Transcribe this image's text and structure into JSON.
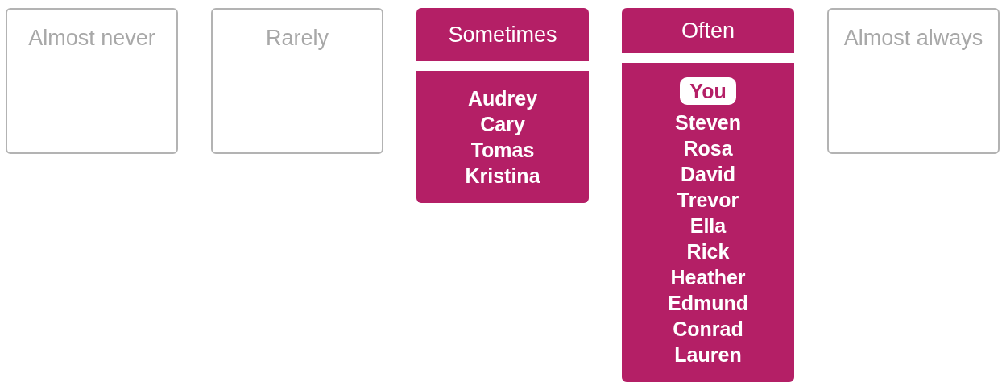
{
  "columns": [
    {
      "label": "Almost never",
      "selected": false
    },
    {
      "label": "Rarely",
      "selected": false
    },
    {
      "label": "Sometimes",
      "selected": true,
      "names": [
        {
          "name": "Audrey",
          "highlighted": false
        },
        {
          "name": "Cary",
          "highlighted": false
        },
        {
          "name": "Tomas",
          "highlighted": false
        },
        {
          "name": "Kristina",
          "highlighted": false
        }
      ]
    },
    {
      "label": "Often",
      "selected": true,
      "names": [
        {
          "name": "You",
          "highlighted": true
        },
        {
          "name": "Steven",
          "highlighted": false
        },
        {
          "name": "Rosa",
          "highlighted": false
        },
        {
          "name": "David",
          "highlighted": false
        },
        {
          "name": "Trevor",
          "highlighted": false
        },
        {
          "name": "Ella",
          "highlighted": false
        },
        {
          "name": "Rick",
          "highlighted": false
        },
        {
          "name": "Heather",
          "highlighted": false
        },
        {
          "name": "Edmund",
          "highlighted": false
        },
        {
          "name": "Conrad",
          "highlighted": false
        },
        {
          "name": "Lauren",
          "highlighted": false
        }
      ]
    },
    {
      "label": "Almost always",
      "selected": false
    }
  ]
}
